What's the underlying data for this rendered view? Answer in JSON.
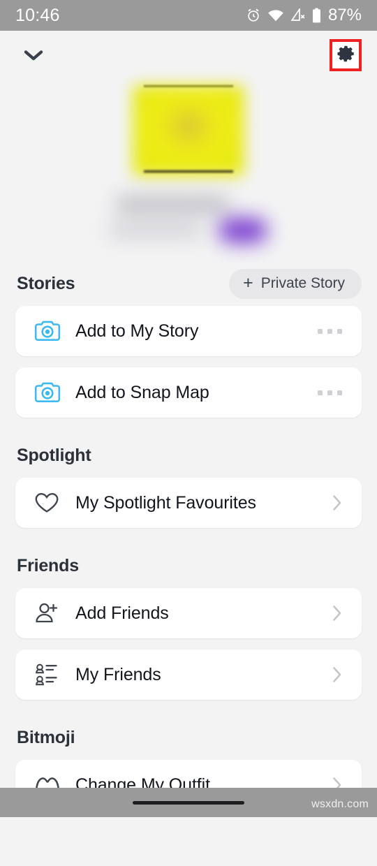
{
  "status_bar": {
    "time": "10:46",
    "battery_percent": "87%",
    "icons": [
      "alarm-icon",
      "wifi-icon",
      "cellular-no-signal-icon",
      "battery-icon"
    ]
  },
  "top_bar": {
    "collapse_icon": "chevron-down-icon",
    "settings_icon": "gear-icon",
    "settings_highlight_color": "#ee2222"
  },
  "profile": {
    "avatar": "blurred-bitmoji-avatar",
    "display_name": "",
    "username": "",
    "badge": "purple-badge"
  },
  "sections": [
    {
      "title": "Stories",
      "action": {
        "label": "Private Story",
        "icon": "plus-icon"
      },
      "items": [
        {
          "label": "Add to My Story",
          "icon": "camera-icon",
          "trailing": "more-options-icon"
        },
        {
          "label": "Add to Snap Map",
          "icon": "camera-icon",
          "trailing": "more-options-icon"
        }
      ]
    },
    {
      "title": "Spotlight",
      "action": null,
      "items": [
        {
          "label": "My Spotlight Favourites",
          "icon": "heart-icon",
          "trailing": "chevron-right-icon"
        }
      ]
    },
    {
      "title": "Friends",
      "action": null,
      "items": [
        {
          "label": "Add Friends",
          "icon": "person-add-icon",
          "trailing": "chevron-right-icon"
        },
        {
          "label": "My Friends",
          "icon": "friends-list-icon",
          "trailing": "chevron-right-icon"
        }
      ]
    },
    {
      "title": "Bitmoji",
      "action": null,
      "items": [
        {
          "label": "Change My Outfit",
          "icon": "bitmoji-icon",
          "trailing": "chevron-right-icon"
        }
      ]
    }
  ],
  "nav_bar": {
    "home_indicator": "home-indicator",
    "watermark": "wsxdn.com"
  },
  "colors": {
    "page_background": "#f3f3f4",
    "card_background": "#ffffff",
    "accent_blue": "#3bb9f0",
    "heading": "#2b3039",
    "system_bar": "#9a9a9a",
    "highlight_red": "#ee2222",
    "badge_purple": "#7b3fcf"
  }
}
